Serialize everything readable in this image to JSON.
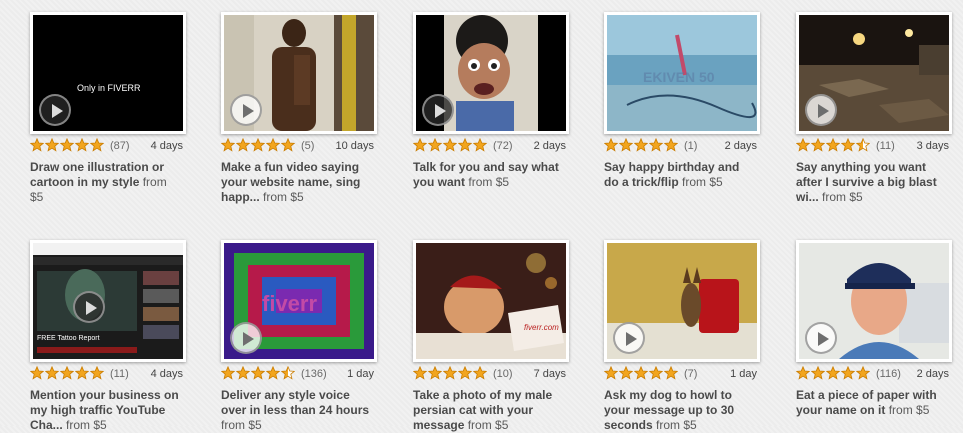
{
  "colors": {
    "star": "#f2a51e",
    "star_outline": "#c97c00"
  },
  "gigs": [
    {
      "title": "Draw one illustration or cartoon in my style",
      "price": "from $5",
      "rating_count": "(87)",
      "stars": 5,
      "delivery": "4 days",
      "thumb_text": "Only in FIVERR",
      "thumb_caption": ""
    },
    {
      "title": "Make a fun video saying your website name, sing happ...",
      "price": "from $5",
      "rating_count": "(5)",
      "stars": 5,
      "delivery": "10 days",
      "thumb_text": "",
      "thumb_caption": ""
    },
    {
      "title": "Talk for you and say what you want",
      "price": "from $5",
      "rating_count": "(72)",
      "stars": 5,
      "delivery": "2 days",
      "thumb_text": "",
      "thumb_caption": ""
    },
    {
      "title": "Say happy birthday and do a trick/flip",
      "price": "from $5",
      "rating_count": "(1)",
      "stars": 5,
      "delivery": "2 days",
      "thumb_text": "EKIVEN 50",
      "thumb_caption": ""
    },
    {
      "title": "Say anything you want after I survive a big blast wi...",
      "price": "from $5",
      "rating_count": "(11)",
      "stars": 4.5,
      "delivery": "3 days",
      "thumb_text": "",
      "thumb_caption": ""
    },
    {
      "title": "Mention your business on my high traffic YouTube Cha...",
      "price": "from $5",
      "rating_count": "(11)",
      "stars": 5,
      "delivery": "4 days",
      "thumb_text": "FREE Tattoo Report",
      "thumb_caption": ""
    },
    {
      "title": "Deliver any style voice over in less than 24 hours",
      "price": "from $5",
      "rating_count": "(136)",
      "stars": 4.5,
      "delivery": "1 day",
      "thumb_text": "fiverr",
      "thumb_caption": ""
    },
    {
      "title": "Take a photo of my male persian cat with your message",
      "price": "from $5",
      "rating_count": "(10)",
      "stars": 5,
      "delivery": "7 days",
      "thumb_text": "fiverr.com",
      "thumb_caption": ""
    },
    {
      "title": "Ask my dog to howl to your message up to 30 seconds",
      "price": "from $5",
      "rating_count": "(7)",
      "stars": 5,
      "delivery": "1 day",
      "thumb_text": "",
      "thumb_caption": ""
    },
    {
      "title": "Eat a piece of paper with your name on it",
      "price": "from $5",
      "rating_count": "(116)",
      "stars": 5,
      "delivery": "2 days",
      "thumb_text": "",
      "thumb_caption": ""
    }
  ]
}
